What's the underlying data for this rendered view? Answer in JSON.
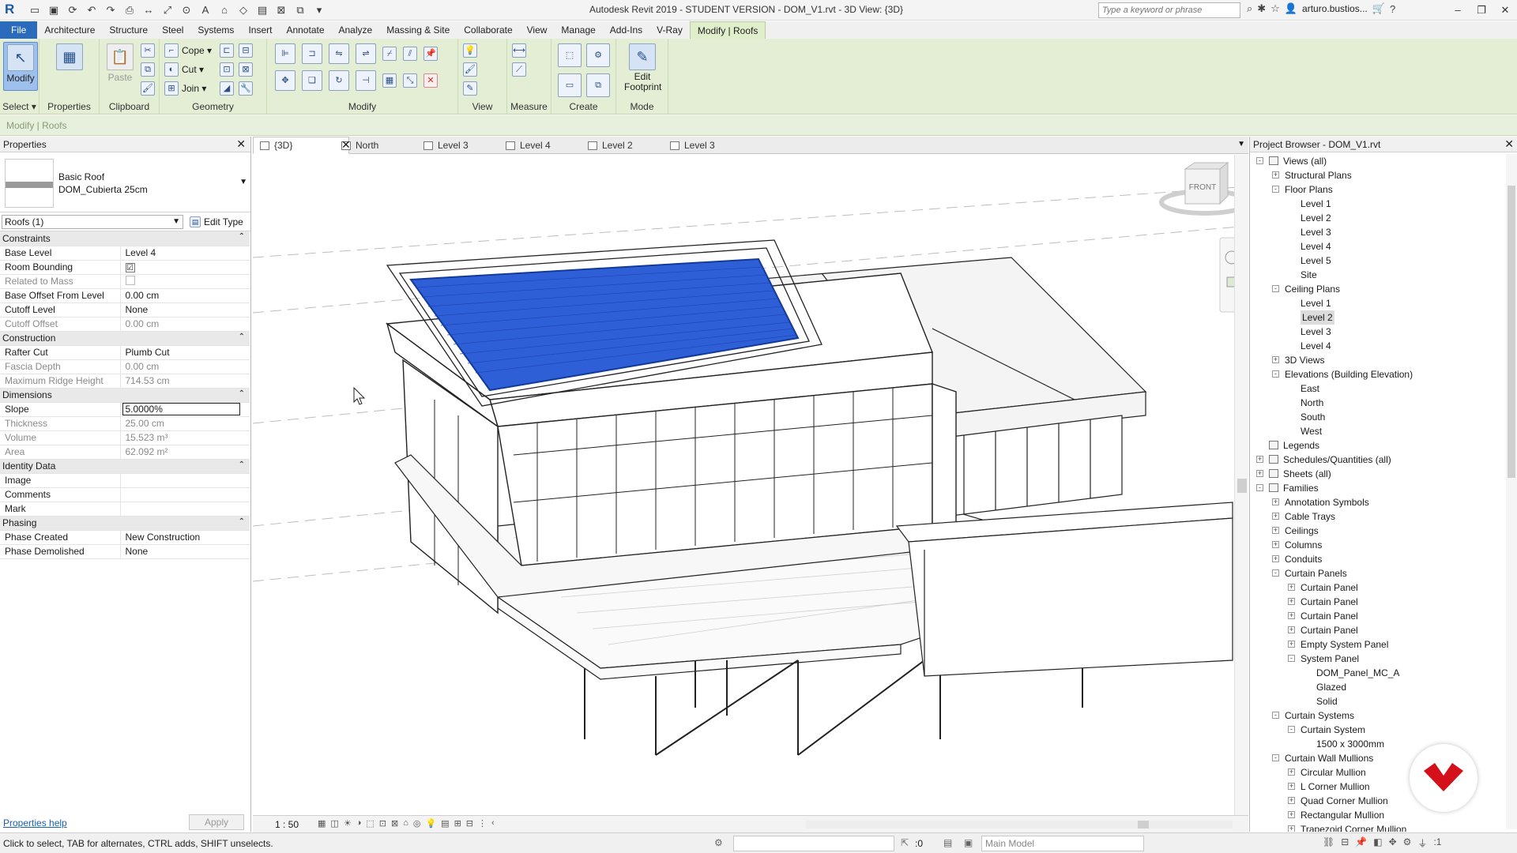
{
  "app": {
    "title": "Autodesk Revit 2019 - STUDENT VERSION - DOM_V1.rvt - 3D View: {3D}",
    "search_placeholder": "Type a keyword or phrase",
    "user": "arturo.bustios..."
  },
  "ribbon_tabs": [
    "File",
    "Architecture",
    "Structure",
    "Steel",
    "Systems",
    "Insert",
    "Annotate",
    "Analyze",
    "Massing & Site",
    "Collaborate",
    "View",
    "Manage",
    "Add-Ins",
    "V-Ray",
    "Modify | Roofs"
  ],
  "ribbon": {
    "modify_btn": "Modify",
    "select_label": "Select ▾",
    "properties_btn": "Properties",
    "properties_panel": "Properties",
    "paste_btn": "Paste",
    "clipboard_panel": "Clipboard",
    "cope": "Cope ▾",
    "cut": "Cut ▾",
    "join": "Join ▾",
    "geometry_panel": "Geometry",
    "modify_panel": "Modify",
    "view_panel": "View",
    "measure_panel": "Measure",
    "create_panel": "Create",
    "edit_footprint_1": "Edit",
    "edit_footprint_2": "Footprint",
    "mode_panel": "Mode"
  },
  "context_bar": "Modify | Roofs",
  "properties": {
    "title": "Properties",
    "type_family": "Basic Roof",
    "type_name": "DOM_Cubierta 25cm",
    "instance_filter": "Roofs (1)",
    "edit_type": "Edit Type",
    "groups": [
      {
        "name": "Constraints",
        "rows": [
          {
            "k": "Base Level",
            "v": "Level 4",
            "ro": false
          },
          {
            "k": "Room Bounding",
            "v": "☑",
            "ro": false,
            "check": "on"
          },
          {
            "k": "Related to Mass",
            "v": "",
            "ro": true,
            "check": "off"
          },
          {
            "k": "Base Offset From Level",
            "v": "0.00 cm",
            "ro": false
          },
          {
            "k": "Cutoff Level",
            "v": "None",
            "ro": false
          },
          {
            "k": "Cutoff Offset",
            "v": "0.00 cm",
            "ro": true
          }
        ]
      },
      {
        "name": "Construction",
        "rows": [
          {
            "k": "Rafter Cut",
            "v": "Plumb Cut",
            "ro": false
          },
          {
            "k": "Fascia Depth",
            "v": "0.00 cm",
            "ro": true
          },
          {
            "k": "Maximum Ridge Height",
            "v": "714.53 cm",
            "ro": true
          }
        ]
      },
      {
        "name": "Dimensions",
        "rows": [
          {
            "k": "Slope",
            "v": "5.0000%",
            "ro": false,
            "edit": true
          },
          {
            "k": "Thickness",
            "v": "25.00 cm",
            "ro": true
          },
          {
            "k": "Volume",
            "v": "15.523 m³",
            "ro": true
          },
          {
            "k": "Area",
            "v": "62.092 m²",
            "ro": true
          }
        ]
      },
      {
        "name": "Identity Data",
        "rows": [
          {
            "k": "Image",
            "v": "",
            "ro": false
          },
          {
            "k": "Comments",
            "v": "",
            "ro": false
          },
          {
            "k": "Mark",
            "v": "",
            "ro": false
          }
        ]
      },
      {
        "name": "Phasing",
        "rows": [
          {
            "k": "Phase Created",
            "v": "New Construction",
            "ro": false
          },
          {
            "k": "Phase Demolished",
            "v": "None",
            "ro": false
          }
        ]
      }
    ],
    "help_link": "Properties help",
    "apply": "Apply"
  },
  "view_tabs": [
    {
      "label": "{3D}",
      "active": true
    },
    {
      "label": "North",
      "active": false
    },
    {
      "label": "Level 3",
      "active": false
    },
    {
      "label": "Level 4",
      "active": false
    },
    {
      "label": "Level 2",
      "active": false
    },
    {
      "label": "Level 3",
      "active": false
    }
  ],
  "viewcube_label": "FRONT",
  "view_control": {
    "scale": "1 : 50"
  },
  "browser": {
    "title": "Project Browser - DOM_V1.rvt",
    "nodes": [
      {
        "l": "Views (all)",
        "d": 0,
        "t": "-",
        "icon": true
      },
      {
        "l": "Structural Plans",
        "d": 1,
        "t": "+"
      },
      {
        "l": "Floor Plans",
        "d": 1,
        "t": "-"
      },
      {
        "l": "Level 1",
        "d": 2
      },
      {
        "l": "Level 2",
        "d": 2
      },
      {
        "l": "Level 3",
        "d": 2
      },
      {
        "l": "Level 4",
        "d": 2
      },
      {
        "l": "Level 5",
        "d": 2
      },
      {
        "l": "Site",
        "d": 2
      },
      {
        "l": "Ceiling Plans",
        "d": 1,
        "t": "-"
      },
      {
        "l": "Level 1",
        "d": 2
      },
      {
        "l": "Level 2",
        "d": 2,
        "sel": true
      },
      {
        "l": "Level 3",
        "d": 2
      },
      {
        "l": "Level 4",
        "d": 2
      },
      {
        "l": "3D Views",
        "d": 1,
        "t": "+"
      },
      {
        "l": "Elevations (Building Elevation)",
        "d": 1,
        "t": "-"
      },
      {
        "l": "East",
        "d": 2
      },
      {
        "l": "North",
        "d": 2
      },
      {
        "l": "South",
        "d": 2
      },
      {
        "l": "West",
        "d": 2
      },
      {
        "l": "Legends",
        "d": 0,
        "icon": true
      },
      {
        "l": "Schedules/Quantities (all)",
        "d": 0,
        "t": "+",
        "icon": true
      },
      {
        "l": "Sheets (all)",
        "d": 0,
        "t": "+",
        "icon": true
      },
      {
        "l": "Families",
        "d": 0,
        "t": "-",
        "icon": true
      },
      {
        "l": "Annotation Symbols",
        "d": 1,
        "t": "+"
      },
      {
        "l": "Cable Trays",
        "d": 1,
        "t": "+"
      },
      {
        "l": "Ceilings",
        "d": 1,
        "t": "+"
      },
      {
        "l": "Columns",
        "d": 1,
        "t": "+"
      },
      {
        "l": "Conduits",
        "d": 1,
        "t": "+"
      },
      {
        "l": "Curtain Panels",
        "d": 1,
        "t": "-"
      },
      {
        "l": "Curtain Panel",
        "d": 2,
        "t": "+"
      },
      {
        "l": "Curtain Panel",
        "d": 2,
        "t": "+"
      },
      {
        "l": "Curtain Panel",
        "d": 2,
        "t": "+"
      },
      {
        "l": "Curtain Panel",
        "d": 2,
        "t": "+"
      },
      {
        "l": "Empty System Panel",
        "d": 2,
        "t": "+"
      },
      {
        "l": "System Panel",
        "d": 2,
        "t": "-"
      },
      {
        "l": "DOM_Panel_MC_A",
        "d": 3
      },
      {
        "l": "Glazed",
        "d": 3
      },
      {
        "l": "Solid",
        "d": 3
      },
      {
        "l": "Curtain Systems",
        "d": 1,
        "t": "-"
      },
      {
        "l": "Curtain System",
        "d": 2,
        "t": "-"
      },
      {
        "l": "1500 x 3000mm",
        "d": 3
      },
      {
        "l": "Curtain Wall Mullions",
        "d": 1,
        "t": "-"
      },
      {
        "l": "Circular Mullion",
        "d": 2,
        "t": "+"
      },
      {
        "l": "L Corner Mullion",
        "d": 2,
        "t": "+"
      },
      {
        "l": "Quad Corner Mullion",
        "d": 2,
        "t": "+"
      },
      {
        "l": "Rectangular Mullion",
        "d": 2,
        "t": "+"
      },
      {
        "l": "Trapezoid Corner Mullion",
        "d": 2,
        "t": "+"
      }
    ]
  },
  "status": {
    "text": "Click to select, TAB for alternates, CTRL adds, SHIFT unselects.",
    "selection_count": ":0",
    "model": "Main Model",
    "filter_count": ":1"
  },
  "colors": {
    "roof_highlight": "#2f5fd6",
    "ribbon_bg": "#e3eed5",
    "file_tab": "#2a6bbd",
    "badge": "#d4111b"
  }
}
